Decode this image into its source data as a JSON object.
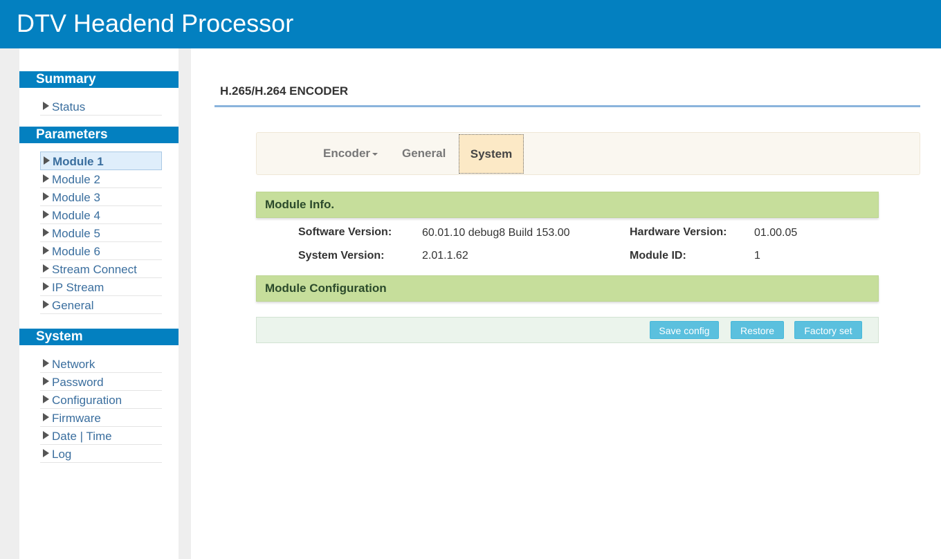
{
  "app": {
    "title": "DTV Headend Processor"
  },
  "sidebar": {
    "summary": {
      "heading": "Summary",
      "items": [
        {
          "label": "Status"
        }
      ]
    },
    "parameters": {
      "heading": "Parameters",
      "items": [
        {
          "label": "Module 1",
          "active": true
        },
        {
          "label": "Module 2"
        },
        {
          "label": "Module 3"
        },
        {
          "label": "Module 4"
        },
        {
          "label": "Module 5"
        },
        {
          "label": "Module 6"
        },
        {
          "label": "Stream Connect"
        },
        {
          "label": "IP Stream"
        },
        {
          "label": "General"
        }
      ]
    },
    "system": {
      "heading": "System",
      "items": [
        {
          "label": "Network"
        },
        {
          "label": "Password"
        },
        {
          "label": "Configuration"
        },
        {
          "label": "Firmware"
        },
        {
          "label": "Date | Time"
        },
        {
          "label": "Log"
        }
      ]
    }
  },
  "main": {
    "page_title": "H.265/H.264 ENCODER",
    "tabs": [
      {
        "label": "Encoder",
        "has_dropdown": true
      },
      {
        "label": "General"
      },
      {
        "label": "System",
        "active": true
      }
    ],
    "module_info": {
      "heading": "Module Info.",
      "software_version_label": "Software Version:",
      "software_version_value": "60.01.10 debug8 Build 153.00",
      "hardware_version_label": "Hardware Version:",
      "hardware_version_value": "01.00.05",
      "system_version_label": "System Version:",
      "system_version_value": "2.01.1.62",
      "module_id_label": "Module ID:",
      "module_id_value": "1"
    },
    "module_config": {
      "heading": "Module Configuration",
      "buttons": {
        "save": "Save config",
        "restore": "Restore",
        "factory": "Factory set"
      }
    }
  },
  "colors": {
    "brand_blue": "#0380c0",
    "section_green": "#c6de9b",
    "button_blue": "#5bc0de",
    "active_tab": "#fce9c6"
  }
}
